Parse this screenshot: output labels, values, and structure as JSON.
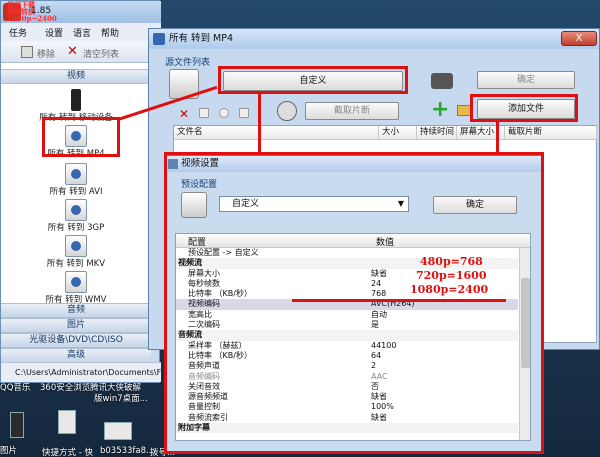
{
  "app": {
    "title": "1.85",
    "watermark": [
      "视频下载",
      "视频转换",
      "1080p→2400"
    ],
    "menu": [
      "任务",
      "设置",
      "语言",
      "帮助"
    ],
    "toolbar": {
      "remove": "移除",
      "clear": "清空列表"
    },
    "sidebar": {
      "category_video": "视频",
      "items": [
        "所有 转到 移动设备",
        "所有 转到 MP4",
        "所有 转到 AVI",
        "所有 转到 3GP",
        "所有 转到 MKV",
        "所有 转到 WMV"
      ],
      "category_audio": "音频",
      "category_image": "图片",
      "category_disc": "光驱设备\\DVD\\CD\\ISO",
      "category_advanced": "高级"
    },
    "status_path": "C:\\Users\\Administrator\\Documents\\FFC"
  },
  "converter": {
    "title": "所有 转到 MP4",
    "close": "X",
    "source_list_label": "源文件列表",
    "custom_button": "自定义",
    "ok_button": "确定",
    "clip_button": "截取片断",
    "add_file_button": "添加文件",
    "columns": [
      "文件名",
      "大小",
      "持续时间",
      "屏幕大小",
      "截取片断"
    ]
  },
  "video_settings": {
    "title": "视频设置",
    "preset_label": "预设配置",
    "preset_value": "自定义",
    "ok_button": "确定",
    "grid_headers": {
      "config": "配置",
      "value": "数值"
    },
    "rows": [
      {
        "name": "预设配置 -> 自定义",
        "value": "",
        "type": "normal"
      },
      {
        "name": "视频流",
        "value": "",
        "type": "section"
      },
      {
        "name": "屏幕大小",
        "value": "缺省",
        "type": "normal"
      },
      {
        "name": "每秒帧数",
        "value": "24",
        "type": "normal"
      },
      {
        "name": "比特率 （KB/秒）",
        "value": "768",
        "type": "normal"
      },
      {
        "name": "视频编码",
        "value": "AVC(H264)",
        "type": "sel"
      },
      {
        "name": "宽高比",
        "value": "自动",
        "type": "normal"
      },
      {
        "name": "二次编码",
        "value": "是",
        "type": "normal"
      },
      {
        "name": "音频流",
        "value": "",
        "type": "section"
      },
      {
        "name": "采样率 （赫兹）",
        "value": "44100",
        "type": "normal"
      },
      {
        "name": "比特率 （KB/秒）",
        "value": "64",
        "type": "normal"
      },
      {
        "name": "音频声道",
        "value": "2",
        "type": "normal"
      },
      {
        "name": "音频编码",
        "value": "AAC",
        "type": "dim"
      },
      {
        "name": "关闭音效",
        "value": "否",
        "type": "normal"
      },
      {
        "name": "源音频频道",
        "value": "缺省",
        "type": "normal"
      },
      {
        "name": "音量控制",
        "value": "100%",
        "type": "normal"
      },
      {
        "name": "音频流索引",
        "value": "缺省",
        "type": "normal"
      },
      {
        "name": "附加字幕",
        "value": "",
        "type": "section"
      }
    ]
  },
  "annotations": [
    "480p=768",
    "720p=1600",
    "1080p=2400"
  ],
  "desktop": {
    "labels": [
      "QQ音乐",
      "360安全浏览",
      "腾讯大侠破解",
      "版win7桌面...",
      "快捷方式 - 快",
      "b03533fa8...",
      "拨号..."
    ],
    "left_edge_label": "图片"
  },
  "colors": {
    "annotation_red": "#e01010",
    "window_frame": "#c7d9ef",
    "desktop": "#1f3d59"
  }
}
